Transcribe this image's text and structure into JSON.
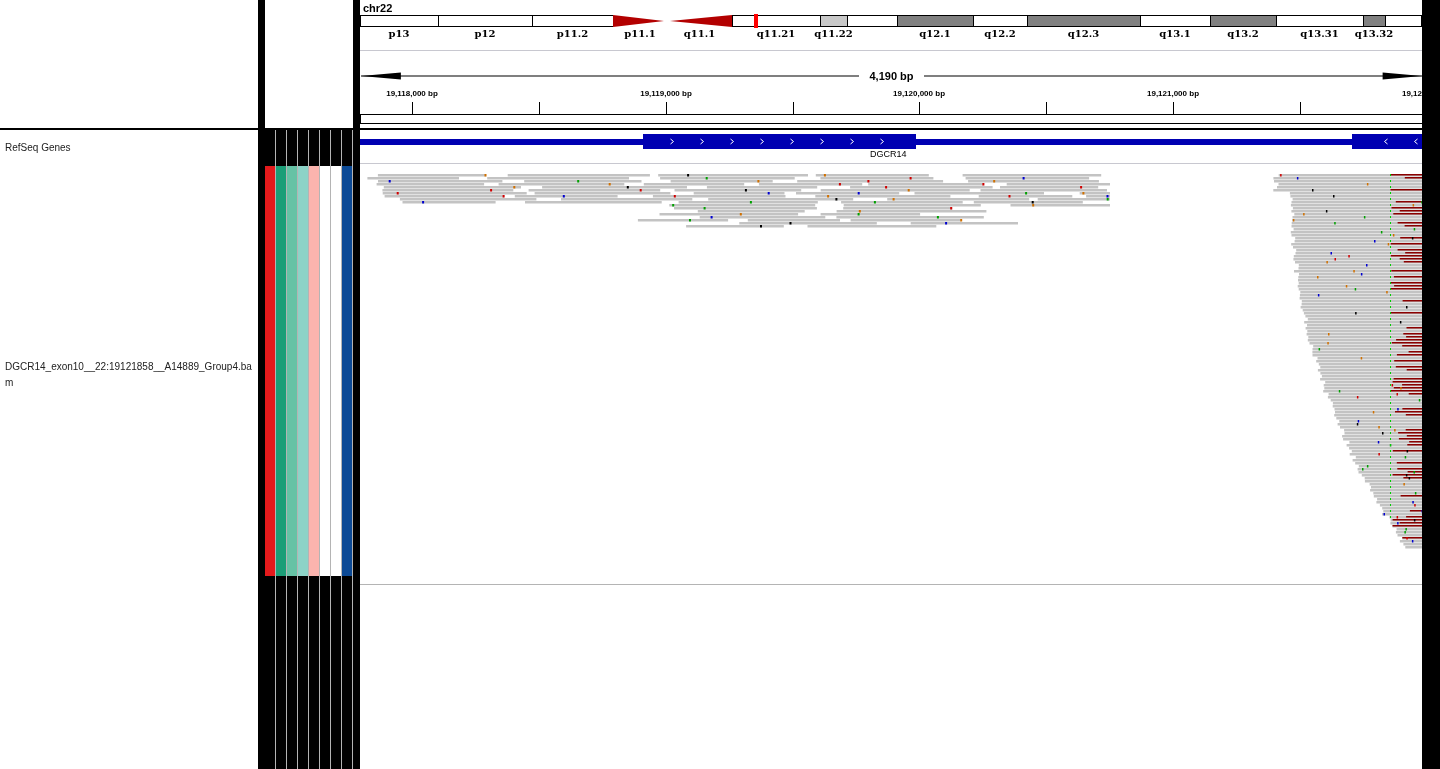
{
  "ideogram": {
    "chromosome": "chr22",
    "bands": [
      {
        "label": "p13",
        "kind": "gneg",
        "current": false
      },
      {
        "label": "p12",
        "kind": "gneg",
        "current": false
      },
      {
        "label": "p11.2",
        "kind": "gneg",
        "current": false
      },
      {
        "label": "p11.1",
        "kind": "acenp",
        "current": false
      },
      {
        "label": "q11.1",
        "kind": "acenq",
        "current": false
      },
      {
        "label": "q11.21",
        "kind": "gneg",
        "current": true
      },
      {
        "label": "q11.22",
        "kind": "gpos25",
        "current": false
      },
      {
        "kind": "gneg",
        "current": false
      },
      {
        "label": "q12.1",
        "kind": "gpos50",
        "current": false
      },
      {
        "label": "q12.2",
        "kind": "gneg",
        "current": false
      },
      {
        "label": "q12.3",
        "kind": "gpos50",
        "current": false
      },
      {
        "label": "q13.1",
        "kind": "gneg",
        "current": false
      },
      {
        "label": "q13.2",
        "kind": "gpos50",
        "current": false
      },
      {
        "label": "q13.31",
        "kind": "gneg",
        "current": false
      },
      {
        "label": "q13.32",
        "kind": "gpos50",
        "current": false
      },
      {
        "kind": "gneg",
        "current": false
      }
    ]
  },
  "ruler": {
    "span": "4,190 bp",
    "ticks": [
      "19,118,000 bp",
      "19,119,000 bp",
      "19,120,000 bp",
      "19,121,000 bp",
      "19,12"
    ]
  },
  "tracks": [
    {
      "name": "RefSeq Genes",
      "kind": "gene",
      "feature": "DGCR14"
    },
    {
      "name": "DGCR14_exon10__22:19121858__A14889_Group4.bam",
      "kind": "alignment"
    }
  ],
  "attributes": [
    {
      "color": "#e41a1c"
    },
    {
      "color": "#1b9e77"
    },
    {
      "color": "#66c2a5"
    },
    {
      "color": "#8dd3c7"
    },
    {
      "color": "#fbb4ae"
    },
    {
      "color": "#ffffff"
    },
    {
      "color": "#ffffff"
    },
    {
      "color": "#0c4a96"
    }
  ]
}
